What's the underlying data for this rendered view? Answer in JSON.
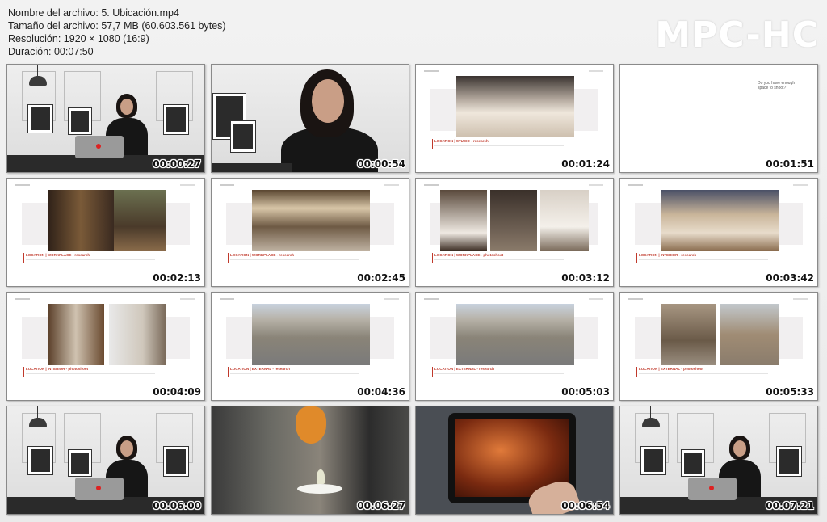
{
  "file_info": {
    "name": "Nombre del archivo: 5. Ubicación.mp4",
    "size": "Tamaño del archivo: 57,7 MB (60.603.561 bytes)",
    "resolution": "Resolución: 1920 × 1080 (16:9)",
    "duration": "Duración: 00:07:50"
  },
  "brand": "MPC-HC",
  "thumbnails": [
    {
      "time": "00:00:27",
      "scene": "presenter-wide"
    },
    {
      "time": "00:00:54",
      "scene": "presenter-close"
    },
    {
      "time": "00:01:24",
      "scene": "slide-studio",
      "label": "LOCATION | STUDIO - research"
    },
    {
      "time": "00:01:51",
      "scene": "slide-question",
      "text": "Do you have enough space to shoot?"
    },
    {
      "time": "00:02:13",
      "scene": "slide-workplace",
      "label": "LOCATION | WORKPLACE - research"
    },
    {
      "time": "00:02:45",
      "scene": "slide-kitchen",
      "label": "LOCATION | WORKPLACE - research"
    },
    {
      "time": "00:03:12",
      "scene": "slide-chef",
      "label": "LOCATION | WORKPLACE - photoshoot"
    },
    {
      "time": "00:03:42",
      "scene": "slide-hotel",
      "label": "LOCATION | INTERIOR - research"
    },
    {
      "time": "00:04:09",
      "scene": "slide-interior",
      "label": "LOCATION | INTERIOR - photoshoot"
    },
    {
      "time": "00:04:36",
      "scene": "slide-palais",
      "label": "LOCATION | EXTERNAL - research"
    },
    {
      "time": "00:05:03",
      "scene": "slide-palais",
      "label": "LOCATION | EXTERNAL - research"
    },
    {
      "time": "00:05:33",
      "scene": "slide-external",
      "label": "LOCATION | EXTERNAL - photoshoot"
    },
    {
      "time": "00:06:00",
      "scene": "presenter-wide"
    },
    {
      "time": "00:06:27",
      "scene": "restaurant"
    },
    {
      "time": "00:06:54",
      "scene": "tablet"
    },
    {
      "time": "00:07:21",
      "scene": "presenter-wide"
    }
  ]
}
